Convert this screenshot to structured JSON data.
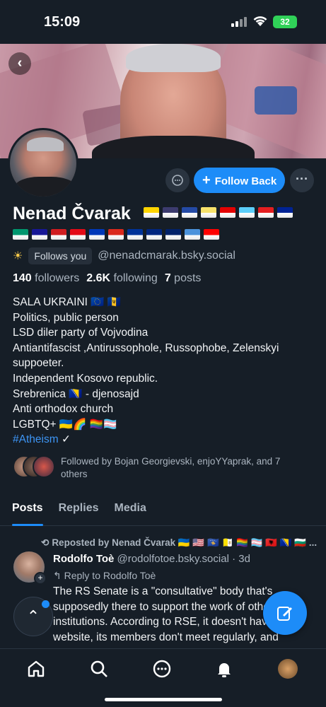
{
  "status_bar": {
    "time": "15:09",
    "battery": "32"
  },
  "profile": {
    "display_name": "Nenad Čvarak",
    "name_flags": [
      "#ffd500",
      "#3c3b6e",
      "#244aa5",
      "#f7e26b",
      "#e40303",
      "#5bcefa",
      "#e41e20",
      "#002395"
    ],
    "flags_row2": [
      "#00966e",
      "#171796",
      "#d01c1f",
      "#e30a17",
      "#0038b8",
      "#da291c",
      "#003399",
      "#00267f",
      "#012169",
      "#4b92db",
      "#fe0000"
    ],
    "follows_you": "Follows you",
    "handle": "@nenadcmarak.bsky.social",
    "followers_count": "140",
    "followers_label": "followers",
    "following_count": "2.6K",
    "following_label": "following",
    "posts_count": "7",
    "posts_label": "posts",
    "bio_lines": [
      "SALA UKRAINI 🇪🇺 🇧🇧",
      "Politics, public person",
      "LSD diler party of Vojvodina",
      "Antiantifascist ,Antirussophole, Russophobe, Zelenskyi suppoeter.",
      "Independent Kosovo republic.",
      "Srebrenica 🇧🇦  - djenosajd",
      "Anti orthodox church",
      "LGBTQ+ 🇺🇦🌈 🏳️‍🌈🏳️‍⚧️"
    ],
    "hashtag": "#Atheism",
    "followed_by": "Followed by Bojan Georgievski, enjoYYaprak, and 7 others"
  },
  "actions": {
    "follow_back": "Follow Back"
  },
  "tabs": [
    "Posts",
    "Replies",
    "Media"
  ],
  "post": {
    "repost_label": "Reposted by Nenad Čvarak 🇺🇦 🇺🇸 🇽🇰 🇻🇦 🏳️‍🌈 🏳️‍⚧️ 🇦🇱 🇧🇦 🇧🇬 ...",
    "author": "Rodolfo Toè",
    "author_handle": "@rodolfotoe.bsky.social",
    "time": "· 3d",
    "reply_to": "Reply to Rodolfo Toè",
    "text": "The RS Senate is a \"consultative\" body that's supposedly there to support the work of other institutions. According to RSE, it doesn't have a website, its members don't meet regularly, and"
  },
  "colors": {
    "accent": "#1d8cf8",
    "background": "#161e27",
    "muted": "#aab4bf"
  },
  "icons": [
    "back-icon",
    "chat-icon",
    "plus-icon",
    "more-icon",
    "sun-icon",
    "chevron-up-icon",
    "compose-icon",
    "home-icon",
    "search-icon",
    "messages-icon",
    "bell-icon"
  ]
}
